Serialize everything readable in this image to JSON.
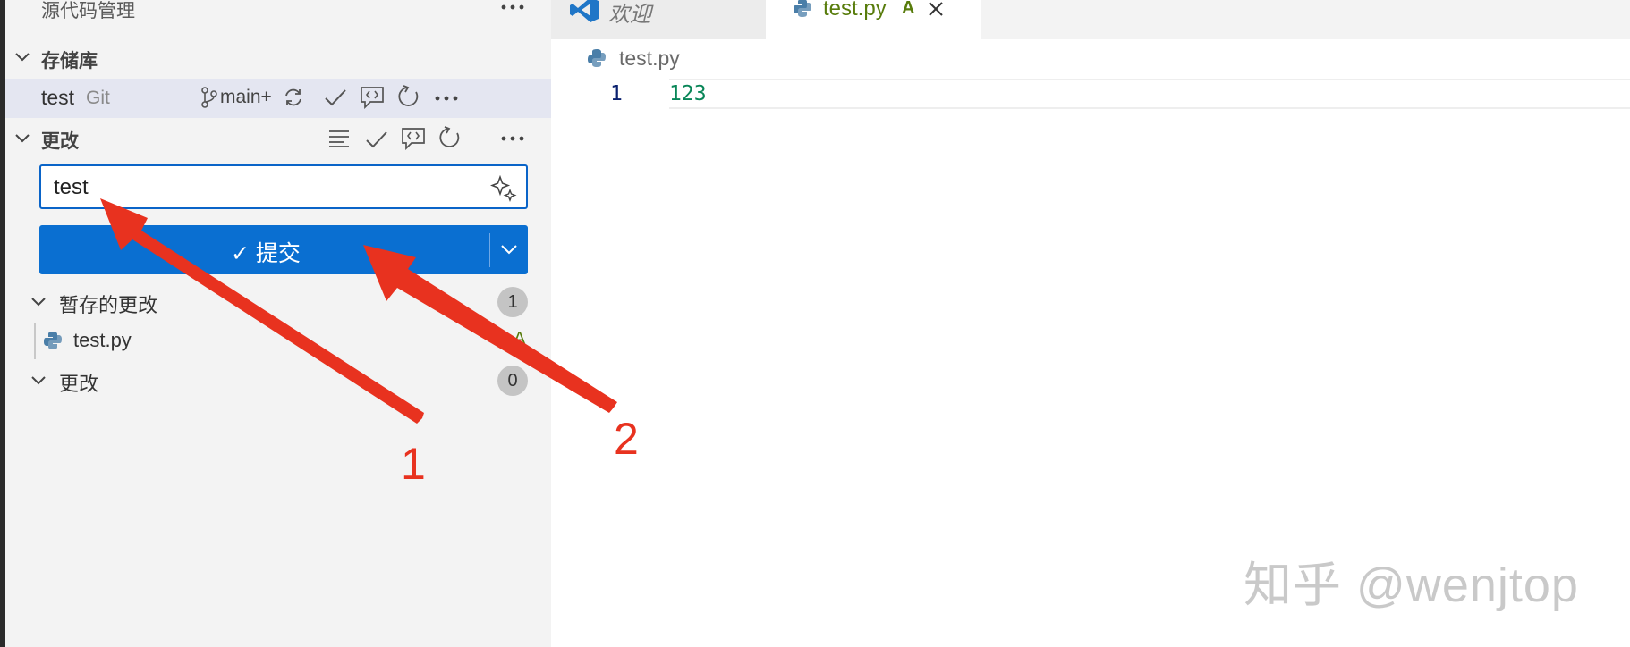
{
  "sidebar": {
    "title": "源代码管理",
    "repositories_section": {
      "label": "存储库"
    },
    "repo": {
      "name": "test",
      "type": "Git",
      "branch": "main+"
    },
    "changes_section": {
      "label": "更改"
    },
    "commit_message": {
      "value": "test"
    },
    "commit_button": {
      "label": "✓ 提交"
    },
    "staged_group": {
      "label": "暂存的更改",
      "count": "1"
    },
    "staged_files": [
      {
        "name": "test.py",
        "status": "A"
      }
    ],
    "changes_group": {
      "label": "更改",
      "count": "0"
    }
  },
  "editor": {
    "tabs": [
      {
        "label": "欢迎"
      },
      {
        "label": "test.py",
        "status": "A"
      }
    ],
    "breadcrumb": "test.py",
    "lines": [
      {
        "number": "1",
        "text": "123"
      }
    ]
  },
  "annotations": {
    "label_1": "1",
    "label_2": "2"
  },
  "watermark": "知乎 @wenjtop",
  "colors": {
    "accent": "#0a6fd1",
    "arrow": "#e8321f",
    "added": "#587c0c"
  }
}
